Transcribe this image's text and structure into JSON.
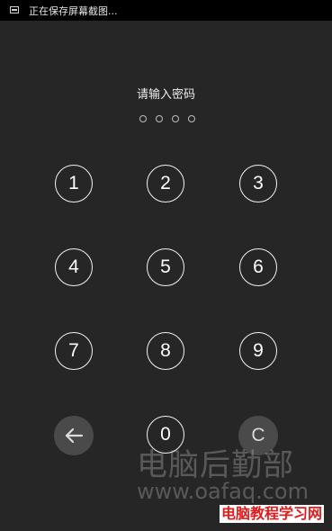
{
  "status_bar": {
    "icon": "screenshot-icon",
    "text": "正在保存屏幕截图..."
  },
  "lock_screen": {
    "prompt": "请输入密码",
    "pin_length": 4,
    "entered": 0
  },
  "keypad": {
    "k1": "1",
    "k2": "2",
    "k3": "3",
    "k4": "4",
    "k5": "5",
    "k6": "6",
    "k7": "7",
    "k8": "8",
    "k9": "9",
    "back_icon": "arrow-left-icon",
    "k0": "0",
    "clear": "C"
  },
  "watermark": {
    "main": "电脑后勤部",
    "url": "www.oafaq.com",
    "red": "电脑教程学习网"
  }
}
